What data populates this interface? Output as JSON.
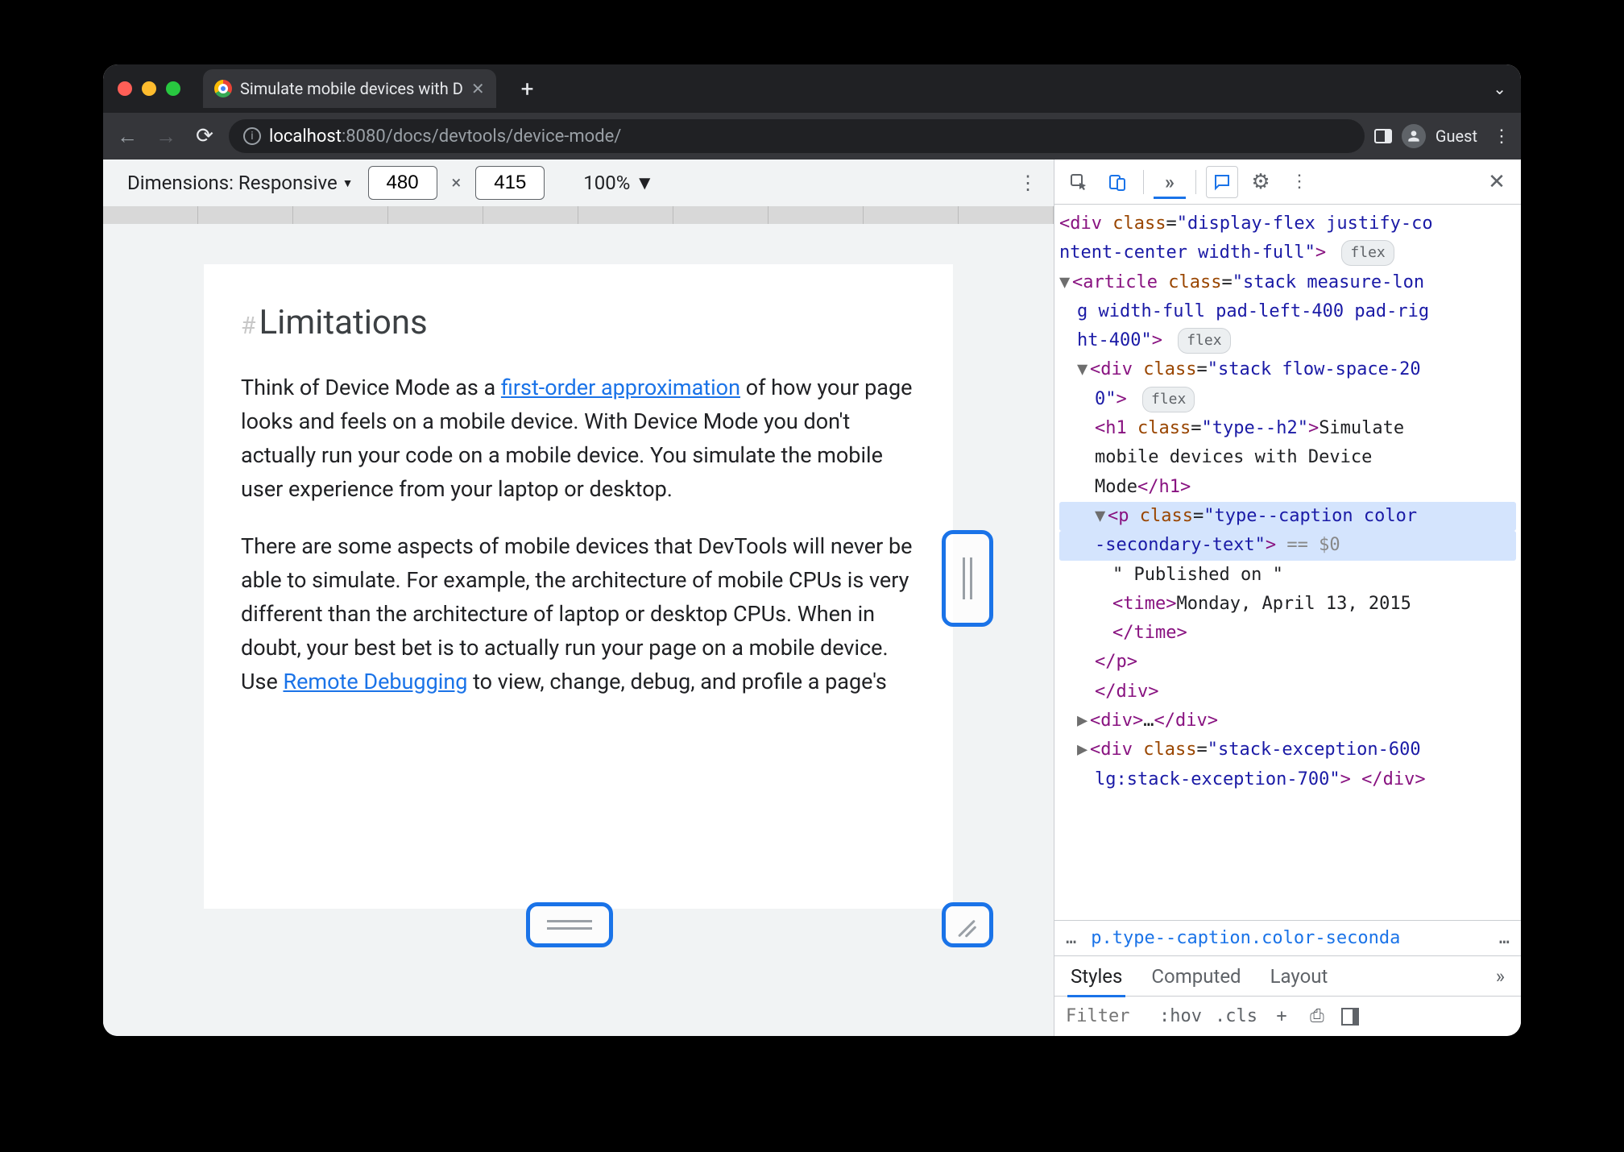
{
  "browser": {
    "tab_title": "Simulate mobile devices with D",
    "url_host": "localhost",
    "url_port": ":8080",
    "url_path": "/docs/devtools/device-mode/",
    "profile": "Guest"
  },
  "device_toolbar": {
    "dimensions_label": "Dimensions: Responsive",
    "width": "480",
    "height": "415",
    "zoom": "100%"
  },
  "page": {
    "heading": "Limitations",
    "para1_a": "Think of Device Mode as a ",
    "link1": "first-order approximation",
    "para1_b": " of how your page looks and feels on a mobile device. With Device Mode you don't actually run your code on a mobile device. You simulate the mobile user experience from your laptop or desktop.",
    "para2_a": "There are some aspects of mobile devices that DevTools will never be able to simulate. For example, the architecture of mobile CPUs is very different than the architecture of laptop or desktop CPUs. When in doubt, your best bet is to actually run your page on a mobile device. Use ",
    "link2": "Remote Debugging",
    "para2_b": " to view, change, debug, and profile a page's"
  },
  "dom": {
    "l1": "<div class=\"display-flex justify-co",
    "l1b": "ntent-center width-full\">",
    "l2a": "<article class=\"stack measure-lon",
    "l2b": "g width-full pad-left-400 pad-rig",
    "l2c": "ht-400\">",
    "l3a": "<div class=\"stack flow-space-20",
    "l3b": "0\">",
    "l4a": "<h1 class=\"type--h2\">Simulate",
    "l4b": "mobile devices with Device",
    "l4c": "Mode</h1>",
    "l5a": "<p class=\"type--caption color",
    "l5b": "-secondary-text\">",
    "l5sel": " == $0",
    "l6": "\" Published on \"",
    "l7a": "<time>Monday, April 13, 2015",
    "l7b": "</time>",
    "l8": "</p>",
    "l9": "</div>",
    "l10": "<div>…</div>",
    "l11a": "<div class=\"stack-exception-600",
    "l11b": "lg:stack-exception-700\"> </div>",
    "flex_pill": "flex"
  },
  "breadcrumb": {
    "ell": "…",
    "path": "p.type--caption.color-seconda",
    "ell2": "…"
  },
  "styles_tabs": [
    "Styles",
    "Computed",
    "Layout"
  ],
  "filter": {
    "placeholder": "Filter",
    "hov": ":hov",
    "cls": ".cls"
  }
}
